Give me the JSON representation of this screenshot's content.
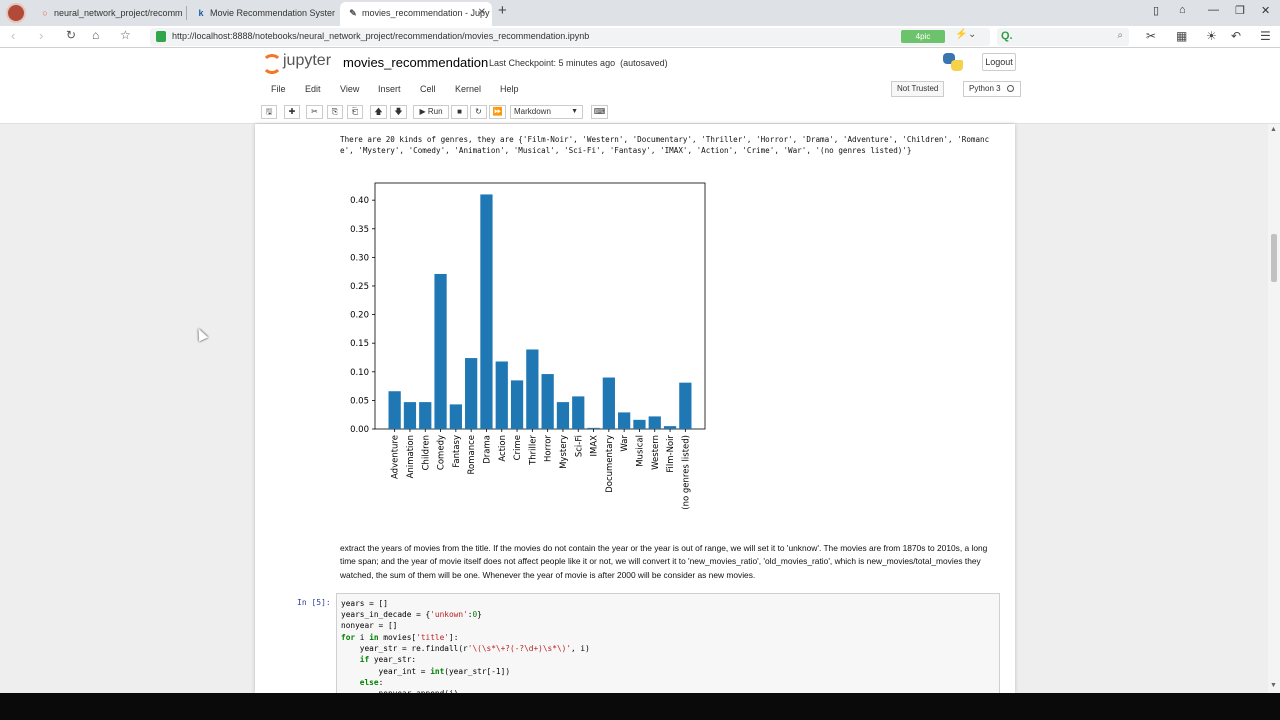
{
  "browser": {
    "tabs": [
      {
        "title": "neural_network_project/recomm",
        "icon": "loading-spinner-icon"
      },
      {
        "title": "Movie Recommendation Syster",
        "icon": "kaggle-icon"
      },
      {
        "title": "movies_recommendation - Jupy",
        "icon": "jupyter-icon"
      }
    ],
    "url": "http://localhost:8888/notebooks/neural_network_project/recommendation/movies_recommendation.ipynb",
    "ext_badge": "4pic"
  },
  "jupyter": {
    "brand": "jupyter",
    "notebook_title": "movies_recommendation",
    "checkpoint": "Last Checkpoint: 5 minutes ago",
    "autosaved": "(autosaved)",
    "logout": "Logout",
    "menu": [
      "File",
      "Edit",
      "View",
      "Insert",
      "Cell",
      "Kernel",
      "Help"
    ],
    "not_trusted": "Not Trusted",
    "kernel": "Python 3",
    "run_label": "Run",
    "cell_type": "Markdown"
  },
  "output_text": "There are 20 kinds of genres, they are {'Film-Noir', 'Western', 'Documentary', 'Thriller', 'Horror', 'Drama', 'Adventure', 'Children', 'Romance', 'Mystery', 'Comedy', 'Animation', 'Musical', 'Sci-Fi', 'Fantasy', 'IMAX', 'Action', 'Crime', 'War', '(no genres listed)'}",
  "chart_data": {
    "type": "bar",
    "categories": [
      "Adventure",
      "Animation",
      "Children",
      "Comedy",
      "Fantasy",
      "Romance",
      "Drama",
      "Action",
      "Crime",
      "Thriller",
      "Horror",
      "Mystery",
      "Sci-Fi",
      "IMAX",
      "Documentary",
      "War",
      "Musical",
      "Western",
      "Film-Noir",
      "(no genres listed)"
    ],
    "values": [
      0.066,
      0.047,
      0.047,
      0.271,
      0.043,
      0.124,
      0.41,
      0.118,
      0.085,
      0.139,
      0.096,
      0.047,
      0.057,
      0.002,
      0.09,
      0.029,
      0.016,
      0.022,
      0.005,
      0.081
    ],
    "yticks": [
      "0.00",
      "0.05",
      "0.10",
      "0.15",
      "0.20",
      "0.25",
      "0.30",
      "0.35",
      "0.40"
    ],
    "ylim": [
      0,
      0.43
    ],
    "bar_color": "#1f77b4",
    "grid": false
  },
  "markdown_text": "extract the years of movies from the title. If the movies do not contain the year or the year is out of range, we will set it to 'unknow'. The movies are from 1870s to 2010s, a long time span; and the year of movie itself does not affect people like it or not, we will convert it to 'new_movies_ratio', 'old_movies_ratio', which is new_movies/total_movies they watched, the sum of them will be one. Whenever the year of movie is after 2000 will be consider as new movies.",
  "code_cell": {
    "prompt": "In [5]:",
    "lines": [
      "years = []",
      "years_in_decade = {'unkown':0}",
      "nonyear = []",
      "for i in movies['title']:",
      "    year_str = re.findall(r'\\(\\s*\\+?(-?\\d+)\\s*\\)', i)",
      "    if year_str:",
      "        year_int = int(year_str[-1])",
      "    else:",
      "        nonyear.append(i)"
    ]
  }
}
